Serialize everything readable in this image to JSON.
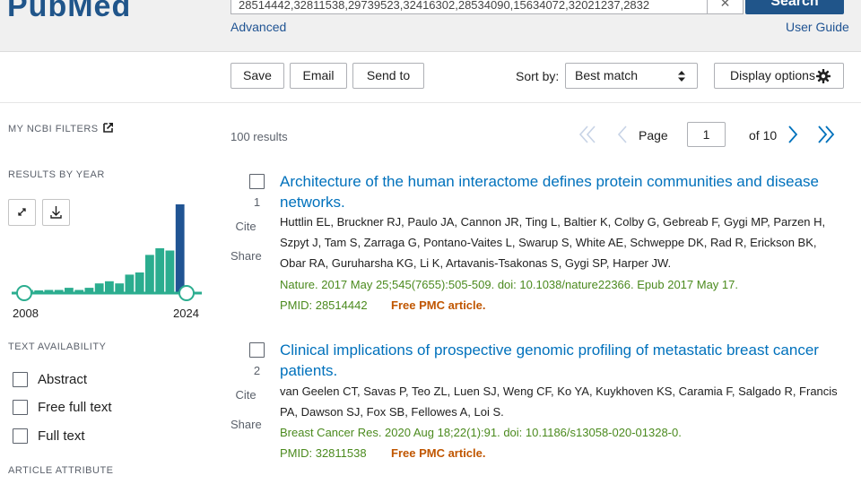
{
  "header": {
    "logo_text": "PubMed",
    "search_value": "28514442,32811538,29739523,32416302,28534090,15634072,32021237,2832",
    "clear_symbol": "✕",
    "search_button": "Search",
    "advanced_link": "Advanced",
    "user_guide_link": "User Guide",
    "brand_color": "#20558a"
  },
  "toolbar": {
    "save": "Save",
    "email": "Email",
    "send_to": "Send to",
    "sort_label": "Sort by:",
    "sort_value": "Best match",
    "display_options": "Display options"
  },
  "sidebar": {
    "my_filters": "MY NCBI FILTERS",
    "results_by_year": "RESULTS BY YEAR",
    "year_start": "2008",
    "year_end": "2024",
    "text_availability": "TEXT AVAILABILITY",
    "filters": [
      {
        "label": "Abstract",
        "checked": false
      },
      {
        "label": "Free full text",
        "checked": false
      },
      {
        "label": "Full text",
        "checked": false
      }
    ],
    "article_attribute": "ARTICLE ATTRIBUTE",
    "histogram_counts": [
      1,
      0,
      1,
      1,
      2,
      1,
      2,
      4,
      5,
      4,
      8,
      9,
      17,
      20,
      19,
      40
    ],
    "histogram_color": "#2bad8f",
    "histogram_highlight": "#205493"
  },
  "pagination": {
    "results_count": "100 results",
    "page_label": "Page",
    "page_value": "1",
    "of_label": "of 10"
  },
  "results": [
    {
      "number": "1",
      "cite": "Cite",
      "share": "Share",
      "title": "Architecture of the human interactome defines protein communities and disease networks.",
      "authors": "Huttlin EL, Bruckner RJ, Paulo JA, Cannon JR, Ting L, Baltier K, Colby G, Gebreab F, Gygi MP, Parzen H, Szpyt J, Tam S, Zarraga G, Pontano-Vaites L, Swarup S, White AE, Schweppe DK, Rad R, Erickson BK, Obar RA, Guruharsha KG, Li K, Artavanis-Tsakonas S, Gygi SP, Harper JW.",
      "citation": "Nature. 2017 May 25;545(7655):505-509. doi: 10.1038/nature22366. Epub 2017 May 17.",
      "pmid": "PMID: 28514442",
      "free": "Free PMC article."
    },
    {
      "number": "2",
      "cite": "Cite",
      "share": "Share",
      "title": "Clinical implications of prospective genomic profiling of metastatic breast cancer patients.",
      "authors": "van Geelen CT, Savas P, Teo ZL, Luen SJ, Weng CF, Ko YA, Kuykhoven KS, Caramia F, Salgado R, Francis PA, Dawson SJ, Fox SB, Fellowes A, Loi S.",
      "citation": "Breast Cancer Res. 2020 Aug 18;22(1):91. doi: 10.1186/s13058-020-01328-0.",
      "pmid": "PMID: 32811538",
      "free": "Free PMC article."
    }
  ]
}
